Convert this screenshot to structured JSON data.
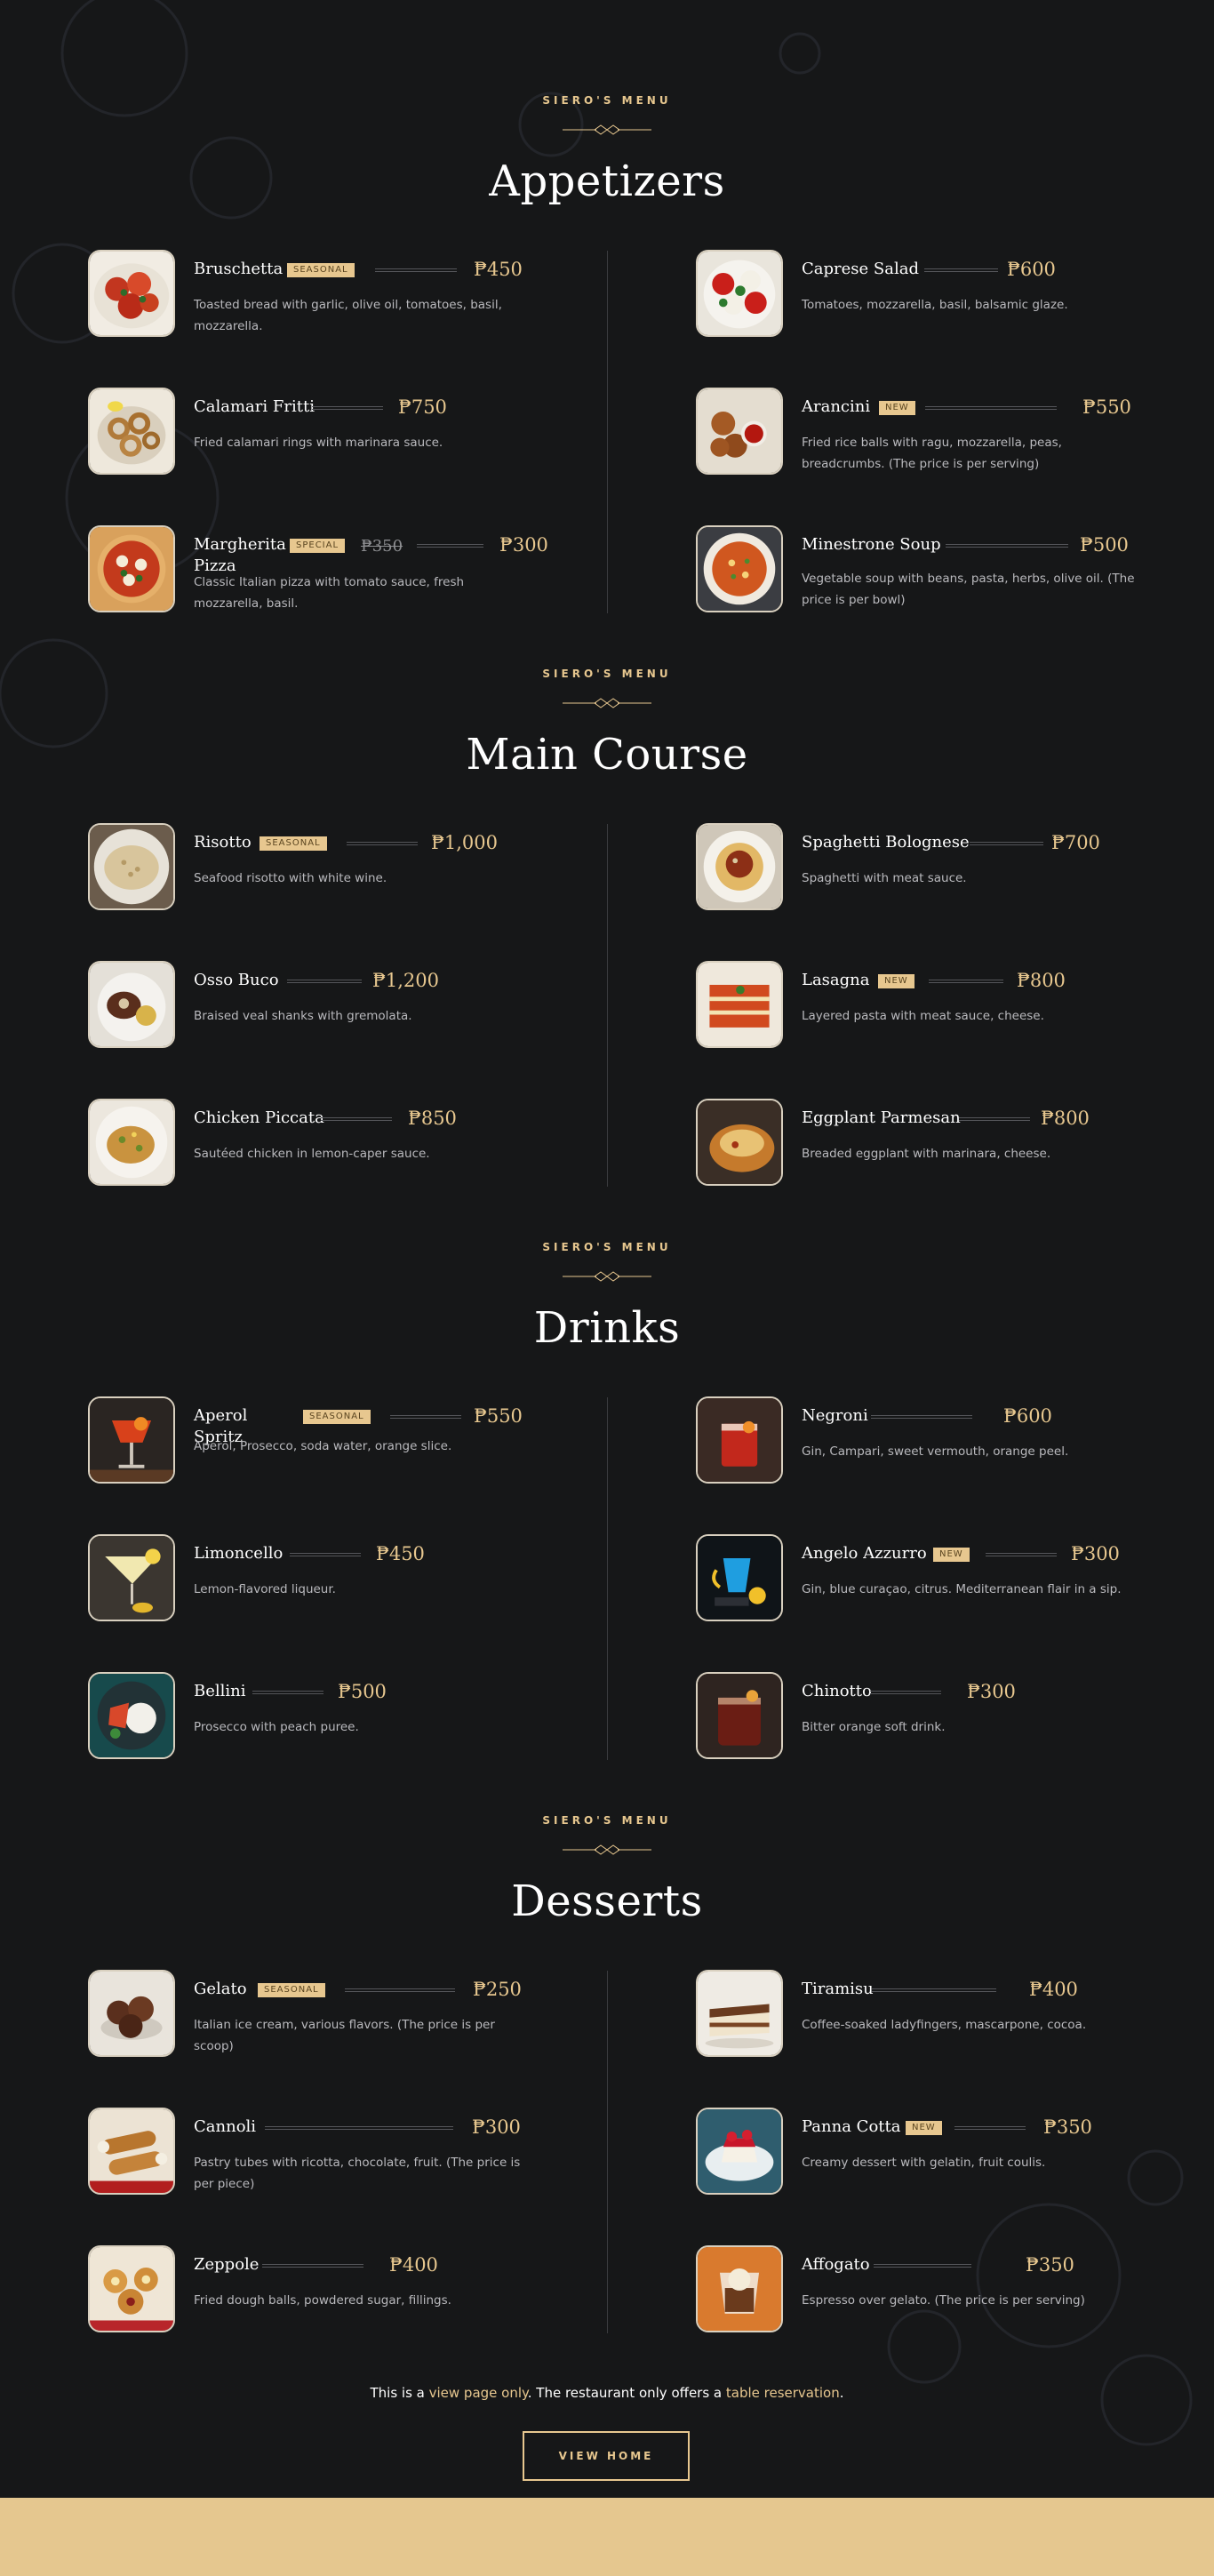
{
  "colors": {
    "background": "#161718",
    "accent": "#e7c78f",
    "text": "#ffffff",
    "muted": "#b9b9bd"
  },
  "sections": [
    {
      "eyebrow": "SIERO'S MENU",
      "title": "Appetizers",
      "items": [
        {
          "name": "Bruschetta",
          "badge": "SEASONAL",
          "price": "₱450",
          "desc": "Toasted bread with garlic, olive oil, tomatoes, basil, mozzarella.",
          "icon": "bruschetta-photo"
        },
        {
          "name": "Caprese Salad",
          "price": "₱600",
          "desc": "Tomatoes, mozzarella, basil, balsamic glaze.",
          "icon": "caprese-salad-photo"
        },
        {
          "name": "Calamari Fritti",
          "price": "₱750",
          "desc": "Fried calamari rings with marinara sauce.",
          "icon": "calamari-photo"
        },
        {
          "name": "Arancini",
          "badge": "NEW",
          "price": "₱550",
          "desc": "Fried rice balls with ragu, mozzarella, peas, breadcrumbs. (The price is per serving)",
          "icon": "arancini-photo"
        },
        {
          "name": "Margherita Pizza",
          "badge": "SPECIAL",
          "old_price": "₱350",
          "price": "₱300",
          "desc": "Classic Italian pizza with tomato sauce, fresh mozzarella, basil.",
          "icon": "pizza-photo"
        },
        {
          "name": "Minestrone Soup",
          "price": "₱500",
          "desc": "Vegetable soup with beans, pasta, herbs, olive oil. (The price is per bowl)",
          "icon": "soup-photo"
        }
      ]
    },
    {
      "eyebrow": "SIERO'S MENU",
      "title": "Main Course",
      "items": [
        {
          "name": "Risotto",
          "badge": "SEASONAL",
          "price": "₱1,000",
          "desc": "Seafood risotto with white wine.",
          "icon": "risotto-photo"
        },
        {
          "name": "Spaghetti Bolognese",
          "price": "₱700",
          "desc": "Spaghetti with meat sauce.",
          "icon": "spaghetti-photo"
        },
        {
          "name": "Osso Buco",
          "price": "₱1,200",
          "desc": "Braised veal shanks with gremolata.",
          "icon": "osso-buco-photo"
        },
        {
          "name": "Lasagna",
          "badge": "NEW",
          "price": "₱800",
          "desc": "Layered pasta with meat sauce, cheese.",
          "icon": "lasagna-photo"
        },
        {
          "name": "Chicken Piccata",
          "price": "₱850",
          "desc": "Sautéed chicken in lemon-caper sauce.",
          "icon": "chicken-piccata-photo"
        },
        {
          "name": "Eggplant Parmesan",
          "price": "₱800",
          "desc": "Breaded eggplant with marinara, cheese.",
          "icon": "eggplant-photo"
        }
      ]
    },
    {
      "eyebrow": "SIERO'S MENU",
      "title": "Drinks",
      "items": [
        {
          "name": "Aperol Spritz",
          "badge": "SEASONAL",
          "price": "₱550",
          "desc": "Aperol, Prosecco, soda water, orange slice.",
          "icon": "aperol-photo"
        },
        {
          "name": "Negroni",
          "price": "₱600",
          "desc": "Gin, Campari, sweet vermouth, orange peel.",
          "icon": "negroni-photo"
        },
        {
          "name": "Limoncello",
          "price": "₱450",
          "desc": "Lemon-flavored liqueur.",
          "icon": "limoncello-photo"
        },
        {
          "name": "Angelo Azzurro",
          "badge": "NEW",
          "price": "₱300",
          "desc": "Gin, blue curaçao, citrus. Mediterranean flair in a sip.",
          "icon": "angelo-azzurro-photo"
        },
        {
          "name": "Bellini",
          "price": "₱500",
          "desc": "Prosecco with peach puree.",
          "icon": "bellini-photo"
        },
        {
          "name": "Chinotto",
          "price": "₱300",
          "desc": "Bitter orange soft drink.",
          "icon": "chinotto-photo"
        }
      ]
    },
    {
      "eyebrow": "SIERO'S MENU",
      "title": "Desserts",
      "items": [
        {
          "name": "Gelato",
          "badge": "SEASONAL",
          "price": "₱250",
          "desc": "Italian ice cream, various flavors. (The price is per scoop)",
          "icon": "gelato-photo"
        },
        {
          "name": "Tiramisu",
          "price": "₱400",
          "desc": "Coffee-soaked ladyfingers, mascarpone, cocoa.",
          "icon": "tiramisu-photo"
        },
        {
          "name": "Cannoli",
          "price": "₱300",
          "desc": "Pastry tubes with ricotta, chocolate, fruit. (The price is per piece)",
          "icon": "cannoli-photo"
        },
        {
          "name": "Panna Cotta",
          "badge": "NEW",
          "price": "₱350",
          "desc": "Creamy dessert with gelatin, fruit coulis.",
          "icon": "panna-cotta-photo"
        },
        {
          "name": "Zeppole",
          "price": "₱400",
          "desc": "Fried dough balls, powdered sugar, fillings.",
          "icon": "zeppole-photo"
        },
        {
          "name": "Affogato",
          "price": "₱350",
          "desc": "Espresso over gelato. (The price is per serving)",
          "icon": "affogato-photo"
        }
      ]
    }
  ],
  "footer": {
    "note_prefix": "This is a ",
    "note_link1": "view page only",
    "note_middle": ". The restaurant only offers a ",
    "note_link2": "table reservation",
    "note_suffix": ".",
    "button_label": "VIEW HOME"
  }
}
